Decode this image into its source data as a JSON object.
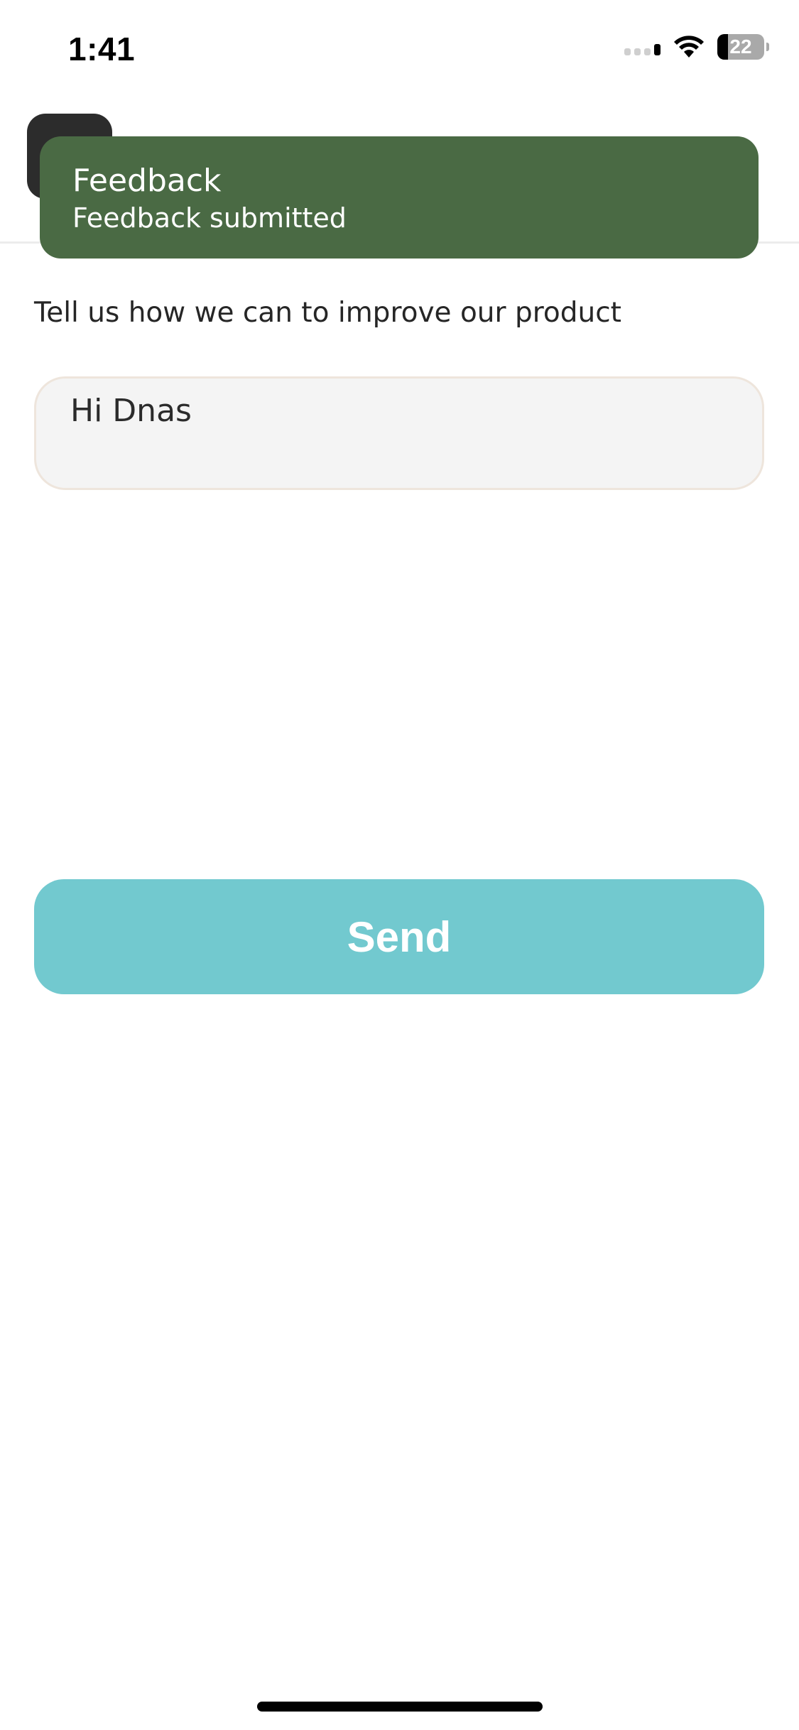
{
  "status_bar": {
    "time": "1:41",
    "battery_level": "22",
    "battery_fraction": 0.22
  },
  "toast": {
    "title": "Feedback",
    "message": "Feedback submitted",
    "background": "#4a6a44"
  },
  "feedback_form": {
    "prompt": "Tell us how we can to improve our product",
    "input_value": "Hi Dnas",
    "send_label": "Send",
    "send_color": "#72c9cf"
  }
}
